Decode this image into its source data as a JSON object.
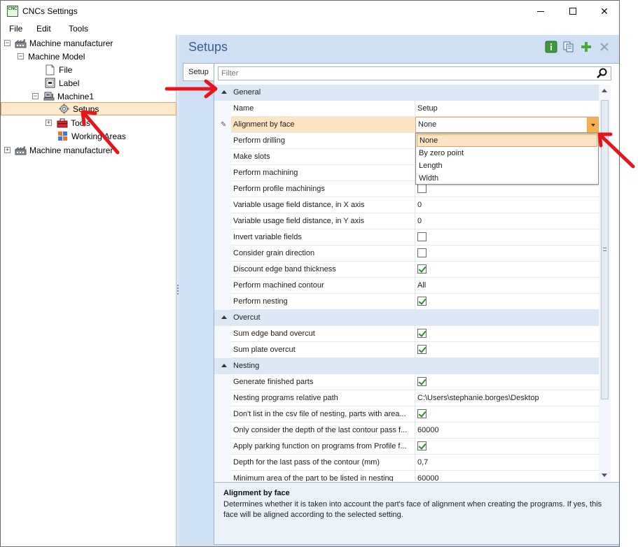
{
  "window": {
    "title": "CNCs Settings",
    "app_icon_text": "CNC",
    "min_symbol": "—",
    "close_symbol": "✕"
  },
  "menu": [
    "File",
    "Edit",
    "Tools"
  ],
  "tree": {
    "items": [
      {
        "label": "Machine manufacturer",
        "expander": "−"
      },
      {
        "label": "Machine Model",
        "expander": "−"
      },
      {
        "label": "File"
      },
      {
        "label": "Label"
      },
      {
        "label": "Machine1",
        "expander": "−"
      },
      {
        "label": "Setups"
      },
      {
        "label": "Tools",
        "expander": "+"
      },
      {
        "label": "Working Areas"
      },
      {
        "label": "Machine manufacturer",
        "expander": "+"
      }
    ]
  },
  "panel": {
    "title": "Setups",
    "tab": "Setup",
    "filter_placeholder": "Filter"
  },
  "grid": {
    "header": {
      "name": "Name",
      "value": "Setup"
    },
    "categories": {
      "general": "General",
      "overcut": "Overcut",
      "nesting": "Nesting"
    },
    "rows": {
      "alignment_by_face": {
        "name": "Alignment by face",
        "value": "None"
      },
      "perform_drilling": {
        "name": "Perform drilling"
      },
      "make_slots": {
        "name": "Make slots"
      },
      "perform_machining": {
        "name": "Perform machining"
      },
      "perform_profile_machinings": {
        "name": "Perform profile machinings",
        "checked": false
      },
      "variable_usage_x": {
        "name": "Variable usage field distance, in X axis",
        "value": "0"
      },
      "variable_usage_y": {
        "name": "Variable usage field distance, in Y axis",
        "value": "0"
      },
      "invert_variable_fields": {
        "name": "Invert variable fields",
        "checked": false
      },
      "consider_grain_direction": {
        "name": "Consider grain direction",
        "checked": false
      },
      "discount_edge_band": {
        "name": "Discount edge band thickness",
        "checked": true
      },
      "perform_machined_contour": {
        "name": "Perform machined contour",
        "value": "All"
      },
      "perform_nesting": {
        "name": "Perform nesting",
        "checked": true
      },
      "sum_edge_band_overcut": {
        "name": "Sum edge band overcut",
        "checked": true
      },
      "sum_plate_overcut": {
        "name": "Sum plate overcut",
        "checked": true
      },
      "generate_finished_parts": {
        "name": "Generate finished parts",
        "checked": true
      },
      "nesting_programs_path": {
        "name": "Nesting programs relative path",
        "value": "C:\\Users\\stephanie.borges\\Desktop"
      },
      "dont_list_csv": {
        "name": "Don't list in the csv file of nesting, parts with area...",
        "checked": true
      },
      "only_consider_depth": {
        "name": "Only consider the depth of the last contour pass f...",
        "value": "60000"
      },
      "apply_parking": {
        "name": "Apply parking function on programs from Profile f...",
        "checked": true
      },
      "depth_last_pass": {
        "name": "Depth for the last pass of the contour (mm)",
        "value": "0,7"
      },
      "minimum_area": {
        "name": "Minimum area of the part to be listed in nesting",
        "value": "60000"
      }
    },
    "dropdown_options": [
      "None",
      "By zero point",
      "Length",
      "Width"
    ],
    "dropdown_selected": "None"
  },
  "description": {
    "title": "Alignment by face",
    "text": "Determines whether it is taken into account the part's face of alignment when creating the programs. If yes, this face will be aligned according to the selected setting."
  },
  "colors": {
    "accent_orange": "#e8a25a",
    "selection": "#fde4c3",
    "panel_blue": "#cfe0f5",
    "annotation_red": "#e8141b"
  }
}
